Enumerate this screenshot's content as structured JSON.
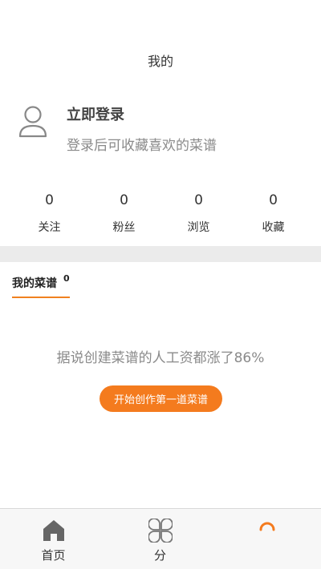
{
  "header": {
    "title": "我的"
  },
  "profile": {
    "login_title": "立即登录",
    "login_subtitle": "登录后可收藏喜欢的菜谱",
    "avatar_icon": "user-outline-icon"
  },
  "stats": [
    {
      "count": "0",
      "label": "关注"
    },
    {
      "count": "0",
      "label": "粉丝"
    },
    {
      "count": "0",
      "label": "浏览"
    },
    {
      "count": "0",
      "label": "收藏"
    }
  ],
  "recipes_tab": {
    "label": "我的菜谱",
    "count": "0"
  },
  "empty_state": {
    "message": "据说创建菜谱的人工资都涨了86%",
    "button_label": "开始创作第一道菜谱"
  },
  "tabbar": {
    "items": [
      {
        "label": "首页",
        "icon": "home-icon"
      },
      {
        "label": "分",
        "icon": "category-icon"
      },
      {
        "label": "",
        "icon": "profile-icon"
      }
    ]
  },
  "colors": {
    "accent": "#f47b1e",
    "tabbar_bg": "#f7f7f7",
    "divider": "#ebebeb"
  }
}
